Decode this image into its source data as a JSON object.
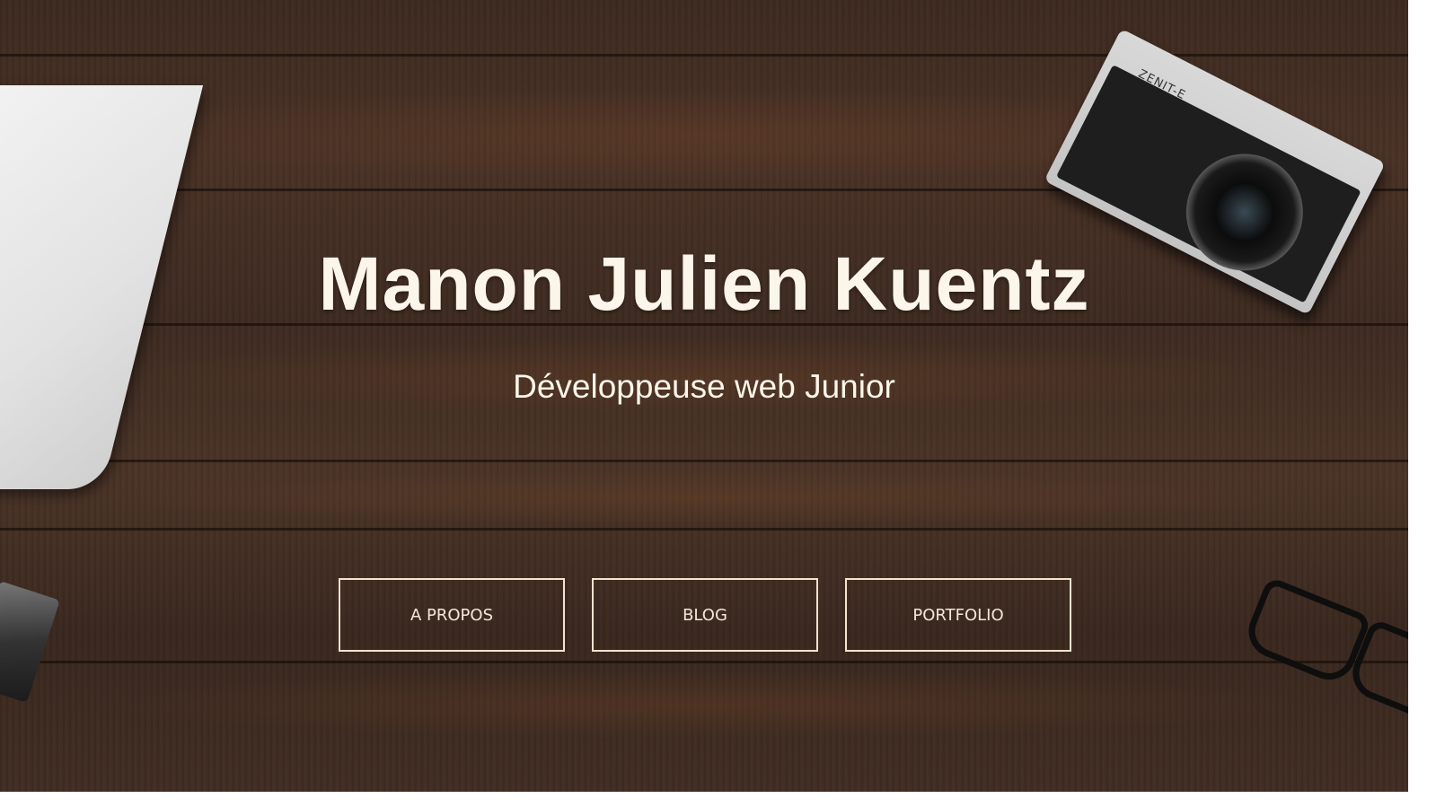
{
  "hero": {
    "title": "Manon Julien Kuentz",
    "subtitle": "Développeuse web Junior",
    "camera_brand": "ZENIT-E"
  },
  "nav": {
    "buttons": [
      {
        "label": "A PROPOS"
      },
      {
        "label": "BLOG"
      },
      {
        "label": "PORTFOLIO"
      }
    ]
  },
  "colors": {
    "background": "#3f2c22",
    "text": "#fbf5ea",
    "button_border": "#f3e3cf"
  }
}
